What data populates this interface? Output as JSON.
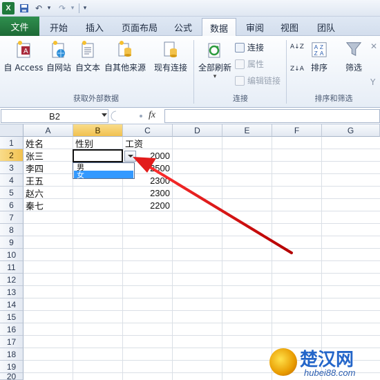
{
  "qat": {
    "app_icon": "X",
    "undo_glyph": "↶",
    "redo_glyph": "↷"
  },
  "tabs": [
    "文件",
    "开始",
    "插入",
    "页面布局",
    "公式",
    "数据",
    "审阅",
    "视图",
    "团队"
  ],
  "active_tab": "数据",
  "ribbon": {
    "get_external": {
      "buttons": [
        "自 Access",
        "自网站",
        "自文本",
        "自其他来源",
        "现有连接"
      ],
      "label": "获取外部数据"
    },
    "connections": {
      "refresh_all": "全部刷新",
      "connections": "连接",
      "properties": "属性",
      "edit_links": "编辑链接",
      "label": "连接"
    },
    "sort_filter": {
      "sort_az": "A↓Z",
      "sort_za": "Z↓A",
      "sort": "排序",
      "filter": "筛选",
      "label": "排序和筛选"
    }
  },
  "formula_bar": {
    "name_box": "B2",
    "fx": "fx",
    "content": ""
  },
  "columns": [
    "A",
    "B",
    "C",
    "D",
    "E",
    "F",
    "G"
  ],
  "rows": [
    "1",
    "2",
    "3",
    "4",
    "5",
    "6",
    "7",
    "8",
    "9",
    "10",
    "11",
    "12",
    "13",
    "14",
    "15",
    "16",
    "17",
    "18",
    "19",
    "20"
  ],
  "sheet": {
    "headers": [
      "姓名",
      "性别",
      "工资"
    ],
    "data": [
      {
        "name": "张三",
        "salary": "2000"
      },
      {
        "name": "李四",
        "salary": "2500"
      },
      {
        "name": "王五",
        "salary": "2300"
      },
      {
        "name": "赵六",
        "salary": "2300"
      },
      {
        "name": "秦七",
        "salary": "2200"
      }
    ]
  },
  "dropdown": {
    "options": [
      "男",
      "女"
    ],
    "highlighted": 1
  },
  "watermark": {
    "name": "楚汉网",
    "domain": "hubei88.com"
  },
  "colors": {
    "accent": "#1f7a3c",
    "arrow": "#d01010",
    "highlight": "#3399ff",
    "selected_header": "#f1c150"
  }
}
